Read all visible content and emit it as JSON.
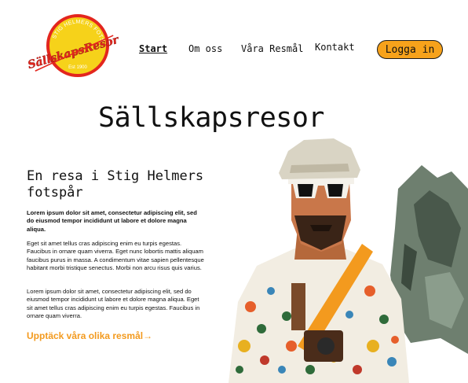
{
  "header": {
    "logo": {
      "arc_text": "STIG HELMERS FOTSPÅR",
      "wordmark": "SällskapsResor",
      "est": "Est 1900"
    },
    "nav": [
      {
        "label": "Start",
        "active": true
      },
      {
        "label": "Om oss",
        "active": false
      },
      {
        "label": "Våra Resmål",
        "active": false
      },
      {
        "label": "Kontakt",
        "active": false
      }
    ],
    "login_label": "Logga in"
  },
  "hero": {
    "title": "Sällskapsresor",
    "subtitle": "En resa i Stig Helmers fotspår",
    "lead": "Lorem ipsum dolor sit amet, consectetur adipiscing elit, sed do eiusmod tempor incididunt ut labore et dolore magna aliqua.",
    "paragraph_1": "Eget sit amet tellus cras adipiscing enim eu turpis egestas. Faucibus in ornare quam viverra. Eget nunc lobortis mattis aliquam faucibus purus in massa. A condimentum vitae sapien pellentesque habitant morbi tristique senectus. Morbi non arcu risus quis varius.",
    "paragraph_2": "Lorem ipsum dolor sit amet, consectetur adipiscing elit, sed do eiusmod tempor incididunt ut labore et dolore magna aliqua. Eget sit amet tellus cras adipiscing enim eu turpis egestas. Faucibus in ornare quam viverra.",
    "cta_label": "Upptäck våra olika resmål→"
  },
  "colors": {
    "accent_orange": "#f7a21b",
    "logo_yellow": "#f6d21a",
    "logo_red": "#e3261e",
    "text": "#111111"
  }
}
